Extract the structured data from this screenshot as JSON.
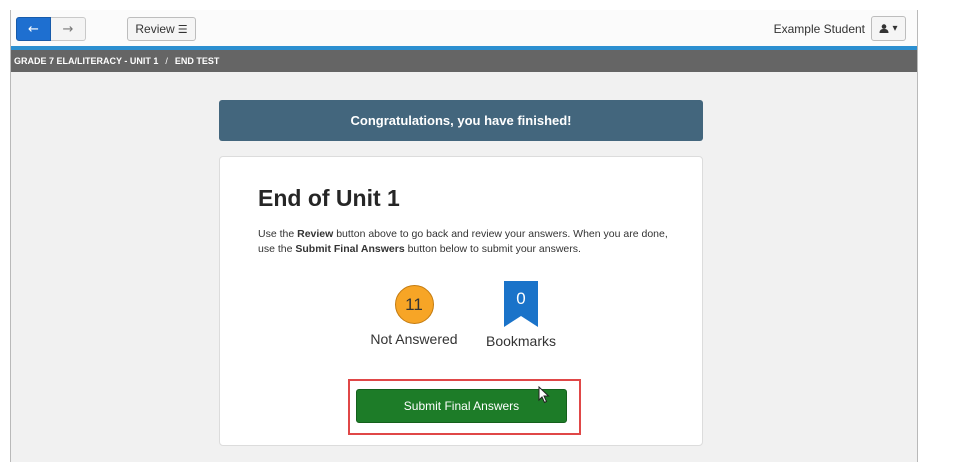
{
  "nav": {
    "back_glyph": "←",
    "forward_glyph": "→",
    "review_label": "Review",
    "review_icon": "☰"
  },
  "user": {
    "name": "Example Student",
    "user_icon": "user-icon",
    "caret": "▾"
  },
  "breadcrumb": {
    "items": [
      "GRADE 7 ELA/LITERACY - UNIT 1",
      "END TEST"
    ],
    "separator": "/"
  },
  "banner": {
    "text": "Congratulations, you have finished!"
  },
  "card": {
    "title": "End of Unit 1",
    "instructions": {
      "part1": "Use the ",
      "review_word": "Review",
      "part2": " button above to go back and review your answers. When you are done, use the ",
      "submit_word": "Submit Final Answers",
      "part3": " button below to submit your answers."
    },
    "stats": {
      "not_answered_count": "11",
      "not_answered_label": "Not Answered",
      "bookmarks_count": "0",
      "bookmarks_label": "Bookmarks"
    },
    "submit_label": "Submit Final Answers"
  },
  "colors": {
    "accent_blue": "#1e6fd0",
    "topbar_border": "#2c8fd0",
    "banner": "#43667d",
    "not_answered": "#f7a526",
    "bookmark": "#1a73c9",
    "submit": "#1d7c28",
    "highlight": "#e04747"
  }
}
